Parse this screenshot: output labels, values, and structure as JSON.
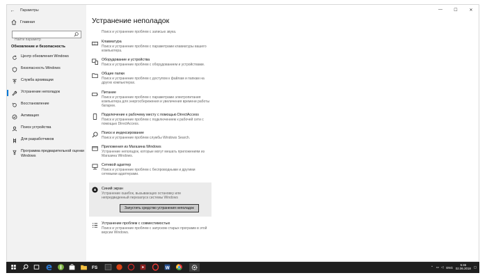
{
  "window": {
    "title": "Параметры",
    "controls": [
      "—",
      "☐",
      "✕"
    ]
  },
  "sidebar": {
    "home_label": "Главная",
    "search_placeholder": "Найти параметр",
    "section_title": "Обновление и безопасность",
    "items": [
      {
        "label": "Центр обновления Windows",
        "icon": "refresh-icon"
      },
      {
        "label": "Безопасность Windows",
        "icon": "shield-icon"
      },
      {
        "label": "Служба архивации",
        "icon": "backup-icon"
      },
      {
        "label": "Устранение неполадок",
        "icon": "wrench-icon",
        "active": true
      },
      {
        "label": "Восстановление",
        "icon": "restore-icon"
      },
      {
        "label": "Активация",
        "icon": "check-circle-icon"
      },
      {
        "label": "Поиск устройства",
        "icon": "person-pin-icon"
      },
      {
        "label": "Для разработчиков",
        "icon": "developer-icon"
      },
      {
        "label": "Программа предварительной оценки Windows",
        "icon": "insider-icon"
      }
    ]
  },
  "main": {
    "title": "Устранение неполадок",
    "top_partial": "Поиск и устранение проблем с записью звука.",
    "items": [
      {
        "title": "Клавиатура",
        "desc": "Поиск и устранение проблем с параметрами клавиатуры вашего компьютера.",
        "icon": "keyboard-icon"
      },
      {
        "title": "Оборудование и устройства",
        "desc": "Поиск и устранение проблем с оборудованием и устройствами.",
        "icon": "hardware-icon"
      },
      {
        "title": "Общие папки",
        "desc": "Поиск и устранение проблем с доступом к файлам и папкам на других компьютерах.",
        "icon": "shared-folder-icon"
      },
      {
        "title": "Питание",
        "desc": "Поиск и устранение проблем с параметрами электропитания компьютера для энергосбережения и увеличения времени работы батареи.",
        "icon": "power-icon"
      },
      {
        "title": "Подключение к рабочему месту с помощью DirectAccess",
        "desc": "Поиск и устранение проблем с подключением к рабочей сети с помощью DirectAccess.",
        "icon": "phone-icon"
      },
      {
        "title": "Поиск и индексирование",
        "desc": "Поиск и устранение проблем службы Windows Search.",
        "icon": "search-icon"
      },
      {
        "title": "Приложения из Магазина Windows",
        "desc": "Устранение неполадок, которые могут мешать приложениям из Магазина Windows.",
        "icon": "store-app-icon"
      },
      {
        "title": "Сетевой адаптер",
        "desc": "Поиск и устранение проблем с беспроводными и другими сетевыми адаптерами.",
        "icon": "network-adapter-icon"
      }
    ],
    "selected": {
      "title": "Синий экран",
      "desc": "Устранение ошибок, вызывающих остановку или непредвиденный перезапуск системы Windows",
      "icon": "close-circle-icon",
      "button": "Запустить средство устранения неполадок"
    },
    "last": {
      "title": "Устранение проблем с совместимостью",
      "desc": "Поиск и устранение проблем с запуском старых программ в этой версии Windows.",
      "icon": "compat-list-icon"
    }
  },
  "taskbar": {
    "lang": "ENG",
    "time": "5:46",
    "date": "02.06.2018",
    "apps": [
      "start-icon",
      "search-icon",
      "task-view-icon",
      "edge-icon",
      "app-green-icon",
      "store-icon",
      "explorer-icon",
      "fs-app-icon",
      "app-dark-icon",
      "game-icon",
      "video-icon",
      "opera-icon",
      "word-icon",
      "chrome-icon",
      "settings-icon"
    ]
  },
  "colors": {
    "accent": "#0078d7",
    "sidebar_bg": "#f2f2f2",
    "taskbar_bg": "#1f1f1f",
    "selected_bg": "#ebebeb"
  }
}
